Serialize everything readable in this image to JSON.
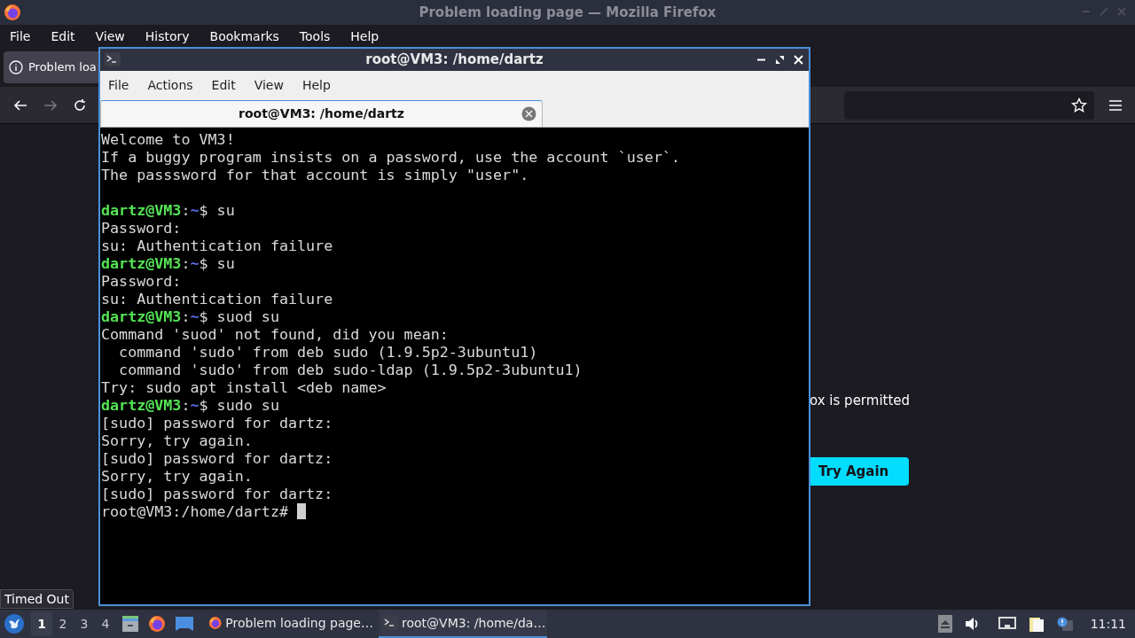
{
  "firefox": {
    "title": "Problem loading page — Mozilla Firefox",
    "menu": [
      "File",
      "Edit",
      "View",
      "History",
      "Bookmarks",
      "Tools",
      "Help"
    ],
    "tab": {
      "label": "Problem loa",
      "selected": true
    },
    "page_text": "ox is permitted",
    "try_again": "Try Again",
    "status": "Timed Out"
  },
  "terminal": {
    "title": "root@VM3: /home/dartz",
    "menu": [
      "File",
      "Actions",
      "Edit",
      "View",
      "Help"
    ],
    "tab": {
      "label": "root@VM3: /home/dartz",
      "selected": true
    },
    "cursor": true,
    "lines": [
      {
        "kind": "text",
        "segments": [
          {
            "kind": "plain",
            "text": "Welcome to VM3!"
          }
        ]
      },
      {
        "kind": "text",
        "segments": [
          {
            "kind": "plain",
            "text": "If a buggy program insists on a password, use the account `user`."
          }
        ]
      },
      {
        "kind": "text",
        "segments": [
          {
            "kind": "plain",
            "text": "The passsword for that account is simply \"user\"."
          }
        ]
      },
      {
        "kind": "blank"
      },
      {
        "kind": "text",
        "segments": [
          {
            "kind": "user",
            "text": "dartz@VM3"
          },
          {
            "kind": "plain",
            "text": ":"
          },
          {
            "kind": "path",
            "text": "~"
          },
          {
            "kind": "plain",
            "text": "$ su"
          }
        ]
      },
      {
        "kind": "text",
        "segments": [
          {
            "kind": "plain",
            "text": "Password:"
          }
        ]
      },
      {
        "kind": "text",
        "segments": [
          {
            "kind": "plain",
            "text": "su: Authentication failure"
          }
        ]
      },
      {
        "kind": "text",
        "segments": [
          {
            "kind": "user",
            "text": "dartz@VM3"
          },
          {
            "kind": "plain",
            "text": ":"
          },
          {
            "kind": "path",
            "text": "~"
          },
          {
            "kind": "plain",
            "text": "$ su"
          }
        ]
      },
      {
        "kind": "text",
        "segments": [
          {
            "kind": "plain",
            "text": "Password:"
          }
        ]
      },
      {
        "kind": "text",
        "segments": [
          {
            "kind": "plain",
            "text": "su: Authentication failure"
          }
        ]
      },
      {
        "kind": "text",
        "segments": [
          {
            "kind": "user",
            "text": "dartz@VM3"
          },
          {
            "kind": "plain",
            "text": ":"
          },
          {
            "kind": "path",
            "text": "~"
          },
          {
            "kind": "plain",
            "text": "$ suod su"
          }
        ]
      },
      {
        "kind": "text",
        "segments": [
          {
            "kind": "plain",
            "text": "Command 'suod' not found, did you mean:"
          }
        ]
      },
      {
        "kind": "text",
        "segments": [
          {
            "kind": "plain",
            "text": "  command 'sudo' from deb sudo (1.9.5p2-3ubuntu1)"
          }
        ]
      },
      {
        "kind": "text",
        "segments": [
          {
            "kind": "plain",
            "text": "  command 'sudo' from deb sudo-ldap (1.9.5p2-3ubuntu1)"
          }
        ]
      },
      {
        "kind": "text",
        "segments": [
          {
            "kind": "plain",
            "text": "Try: sudo apt install <deb name>"
          }
        ]
      },
      {
        "kind": "text",
        "segments": [
          {
            "kind": "user",
            "text": "dartz@VM3"
          },
          {
            "kind": "plain",
            "text": ":"
          },
          {
            "kind": "path",
            "text": "~"
          },
          {
            "kind": "plain",
            "text": "$ sudo su"
          }
        ]
      },
      {
        "kind": "text",
        "segments": [
          {
            "kind": "plain",
            "text": "[sudo] password for dartz:"
          }
        ]
      },
      {
        "kind": "text",
        "segments": [
          {
            "kind": "plain",
            "text": "Sorry, try again."
          }
        ]
      },
      {
        "kind": "text",
        "segments": [
          {
            "kind": "plain",
            "text": "[sudo] password for dartz:"
          }
        ]
      },
      {
        "kind": "text",
        "segments": [
          {
            "kind": "plain",
            "text": "Sorry, try again."
          }
        ]
      },
      {
        "kind": "text",
        "segments": [
          {
            "kind": "plain",
            "text": "[sudo] password for dartz:"
          }
        ]
      },
      {
        "kind": "text",
        "segments": [
          {
            "kind": "plain",
            "text": "root@VM3:/home/dartz# "
          }
        ]
      }
    ]
  },
  "taskbar": {
    "workspaces": [
      {
        "label": "1",
        "selected": true
      },
      {
        "label": "2",
        "selected": false
      },
      {
        "label": "3",
        "selected": false
      },
      {
        "label": "4",
        "selected": false
      }
    ],
    "tasks": [
      {
        "kind": "browser",
        "label": "Problem loading page…",
        "selected": false
      },
      {
        "kind": "terminal",
        "label": "root@VM3: /home/da…",
        "selected": true
      }
    ],
    "clock": "11:11"
  }
}
